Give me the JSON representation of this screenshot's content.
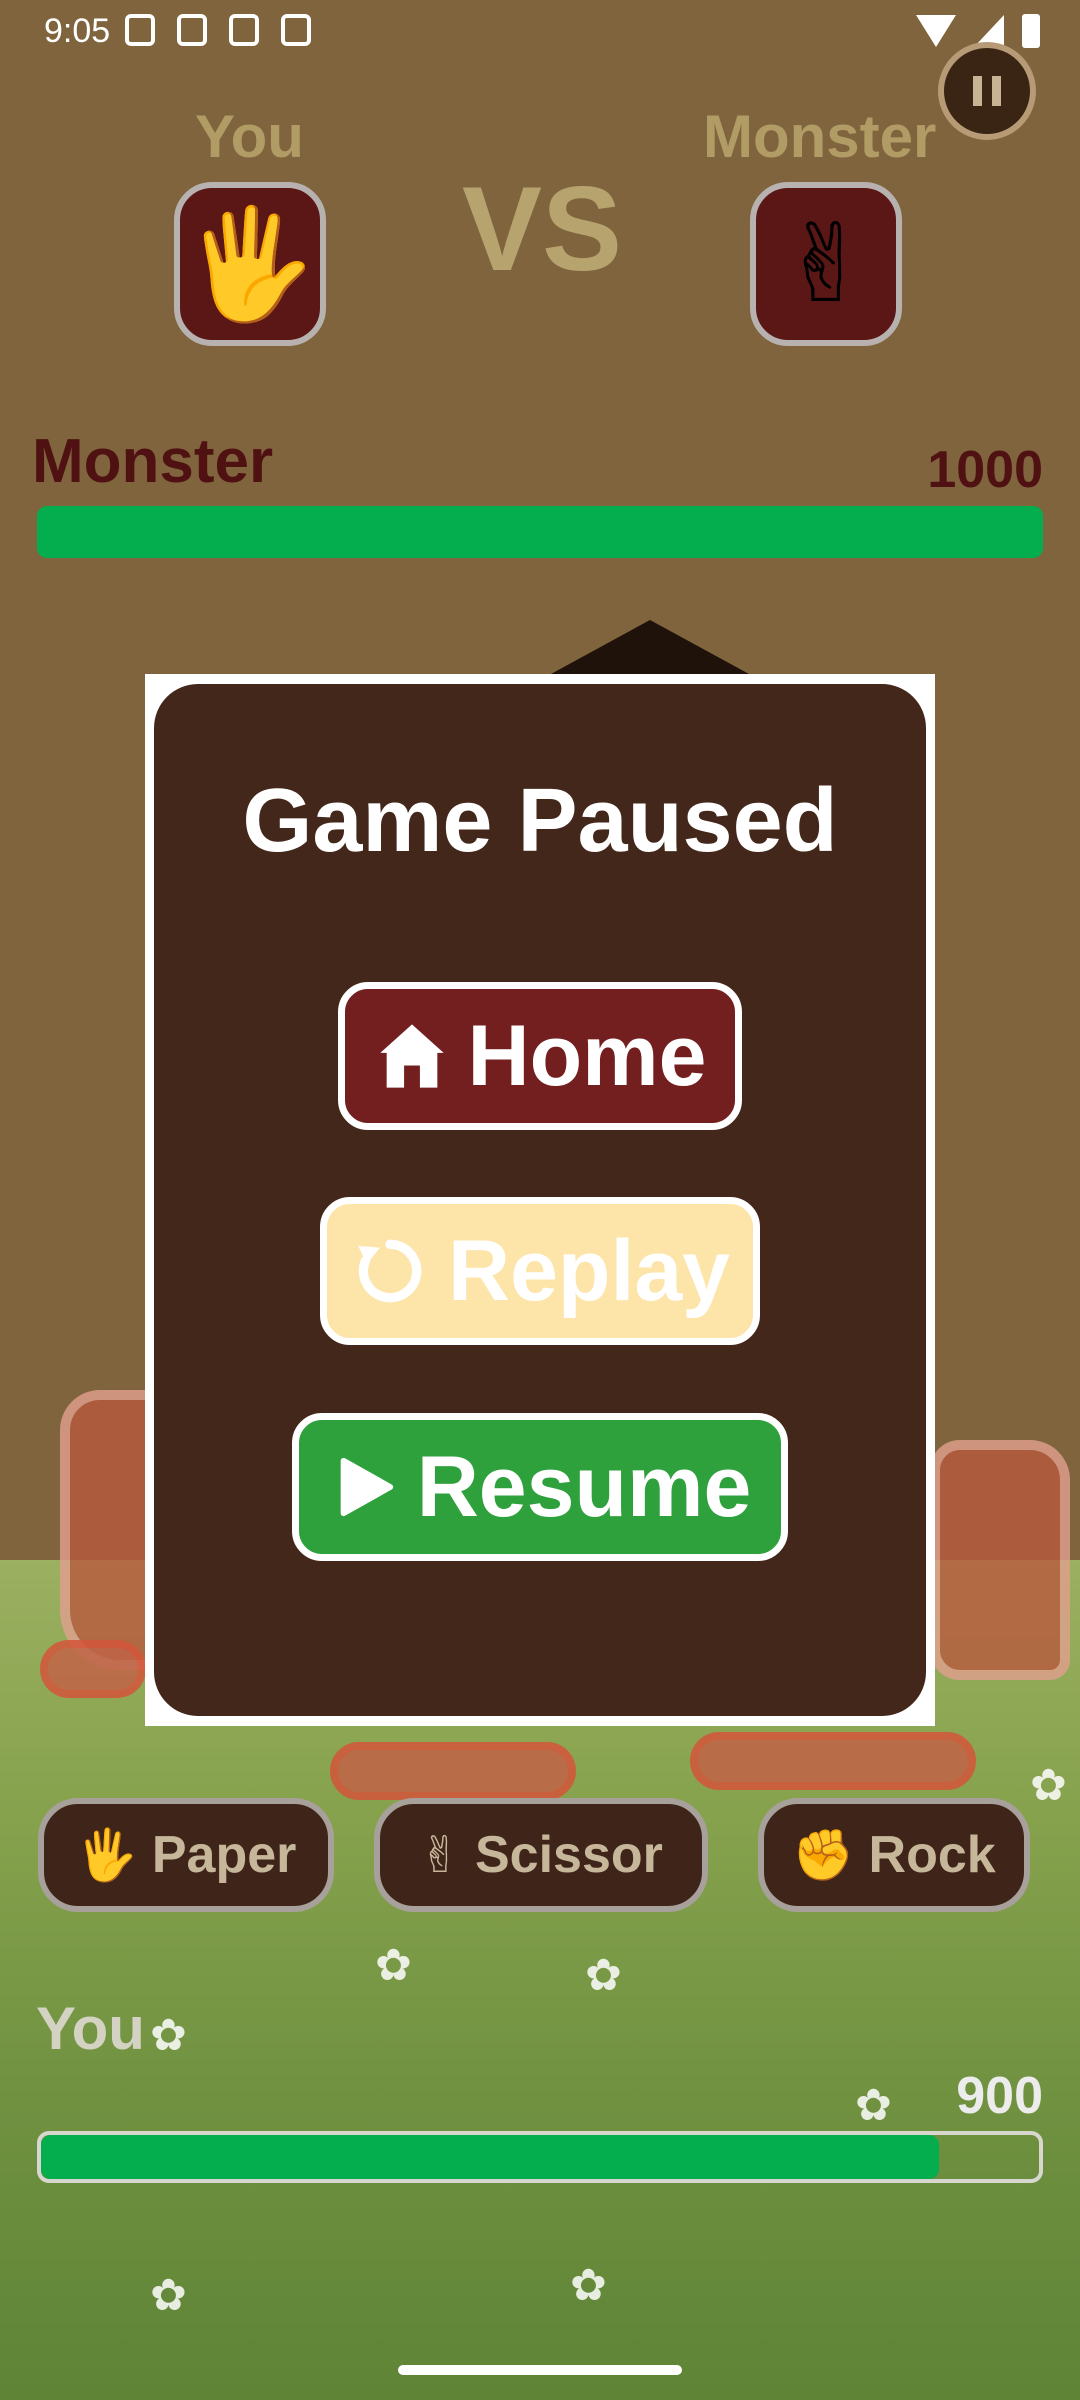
{
  "status_bar": {
    "time": "9:05"
  },
  "header": {
    "player_label": "You",
    "opponent_label": "Monster",
    "vs_text": "VS",
    "player_choice_icon": "paper-hand-icon",
    "opponent_choice_icon": "scissor-hand-icon"
  },
  "monster_hp": {
    "label": "Monster",
    "value": "1000",
    "fraction": 1.0
  },
  "actions": [
    {
      "label": "Paper",
      "icon": "paper-hand-icon"
    },
    {
      "label": "Scissor",
      "icon": "scissor-hand-icon"
    },
    {
      "label": "Rock",
      "icon": "rock-fist-icon"
    }
  ],
  "player_hp": {
    "label": "You",
    "value": "900",
    "fraction": 0.9
  },
  "pause_dialog": {
    "title": "Game Paused",
    "home_label": "Home",
    "replay_label": "Replay",
    "resume_label": "Resume"
  },
  "colors": {
    "background": "#7f643d",
    "dialog": "#44271b",
    "home_button": "#731f1f",
    "replay_button": "#fde4a9",
    "resume_button": "#2ea13d",
    "hp_fill": "#04ad4d"
  }
}
